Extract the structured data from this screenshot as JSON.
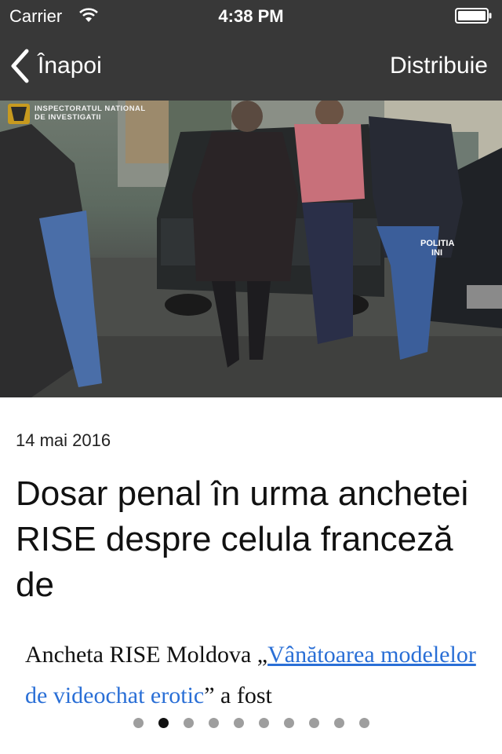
{
  "status_bar": {
    "carrier": "Carrier",
    "time": "4:38 PM"
  },
  "nav": {
    "back_label": "Înapoi",
    "share_label": "Distribuie"
  },
  "hero": {
    "logo_text_line1": "INSPECTORATUL NATIONAL",
    "logo_text_line2": "DE INVESTIGATII",
    "vest_text_line1": "POLITIA",
    "vest_text_line2": "INI"
  },
  "article": {
    "date": "14 mai 2016",
    "title": "Dosar penal în urma anchetei RISE despre celula franceză de",
    "body_prefix": "Ancheta RISE Moldova „",
    "body_link": "Vânătoarea modelelor de videochat erotic",
    "body_suffix": "” a fost"
  },
  "pagination": {
    "total": 10,
    "current": 2
  }
}
